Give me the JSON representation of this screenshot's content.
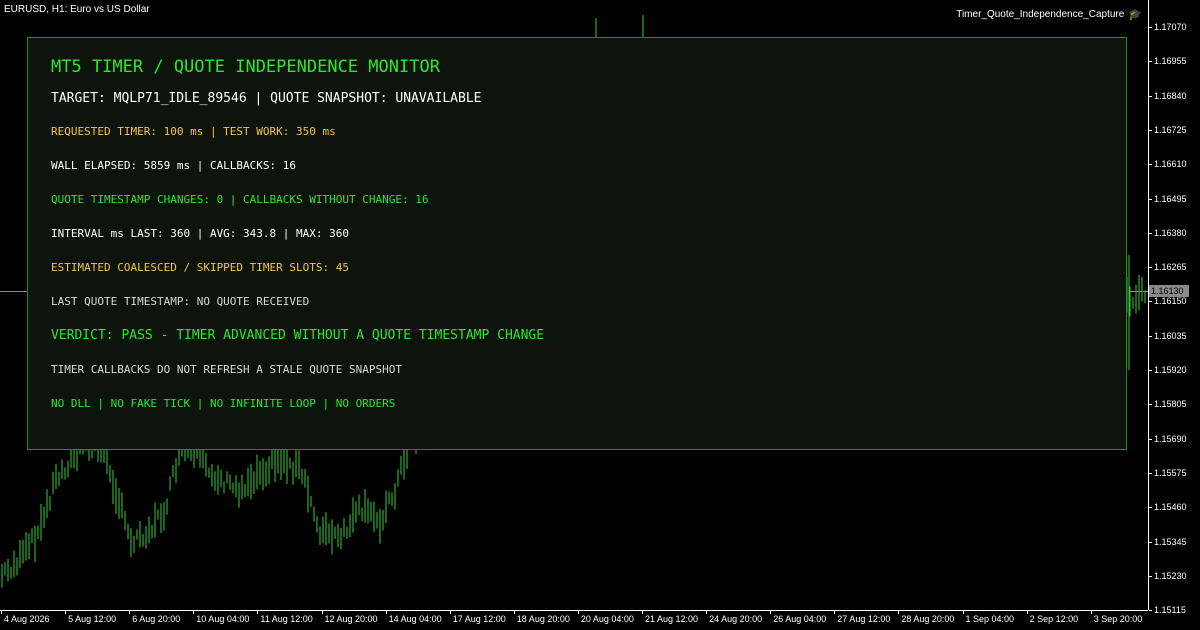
{
  "chart": {
    "symbol_label": "EURUSD, H1:  Euro vs US Dollar",
    "ea_name": "Timer_Quote_Independence_Capture",
    "ea_icon": "graduation-cap-icon",
    "current_price": "1.16130",
    "candle_color": "#33cc33",
    "price_ticks": [
      "1.17070",
      "1.16955",
      "1.16840",
      "1.16725",
      "1.16610",
      "1.16495",
      "1.16380",
      "1.16265",
      "1.16150",
      "1.16035",
      "1.15920",
      "1.15805",
      "1.15690",
      "1.15575",
      "1.15460",
      "1.15345",
      "1.15230",
      "1.15115"
    ],
    "time_ticks": [
      "4 Aug 2026",
      "5 Aug 12:00",
      "6 Aug 20:00",
      "10 Aug 04:00",
      "11 Aug 12:00",
      "12 Aug 20:00",
      "14 Aug 04:00",
      "17 Aug 12:00",
      "18 Aug 20:00",
      "20 Aug 04:00",
      "21 Aug 12:00",
      "24 Aug 20:00",
      "26 Aug 04:00",
      "27 Aug 12:00",
      "28 Aug 20:00",
      "1 Sep 04:00",
      "2 Sep 12:00",
      "3 Sep 20:00"
    ]
  },
  "monitor": {
    "title": "MT5 TIMER / QUOTE INDEPENDENCE MONITOR",
    "target_line": "TARGET: MQLP71_IDLE_89546  |  QUOTE SNAPSHOT: UNAVAILABLE",
    "timer_line": "REQUESTED TIMER: 100 ms  |  TEST WORK: 350 ms",
    "elapsed_line": "WALL ELAPSED: 5859 ms  |  CALLBACKS: 16",
    "quote_changes_line": "QUOTE TIMESTAMP CHANGES: 0  |  CALLBACKS WITHOUT CHANGE: 16",
    "interval_line": "INTERVAL ms  LAST: 360  |  AVG: 343.8  |  MAX: 360",
    "coalesced_line": "ESTIMATED COALESCED / SKIPPED TIMER SLOTS: 45",
    "last_quote_line": "LAST QUOTE TIMESTAMP: NO QUOTE RECEIVED",
    "verdict": "VERDICT: PASS - TIMER ADVANCED WITHOUT A QUOTE TIMESTAMP CHANGE",
    "note_line": "TIMER CALLBACKS DO NOT REFRESH A STALE QUOTE SNAPSHOT",
    "constraints_line": "NO DLL  |  NO FAKE TICK  |  NO INFINITE LOOP  |  NO ORDERS",
    "colors": {
      "title": "#2ee62e",
      "border": "#2a8a2a",
      "yellow": "#f5c542",
      "green": "#2ee62e"
    }
  }
}
